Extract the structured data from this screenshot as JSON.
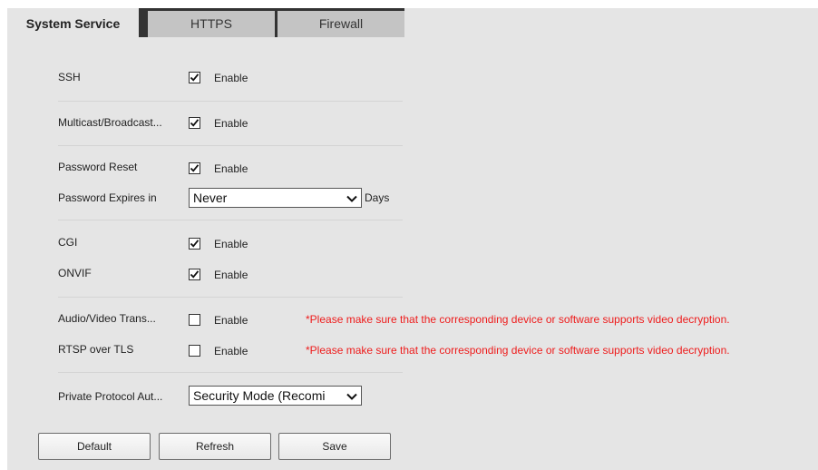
{
  "tabs": [
    {
      "label": "System Service",
      "active": true
    },
    {
      "label": "HTTPS",
      "active": false
    },
    {
      "label": "Firewall",
      "active": false
    }
  ],
  "settings": {
    "ssh": {
      "label": "SSH",
      "checked": true,
      "option": "Enable"
    },
    "multicast": {
      "label": "Multicast/Broadcast...",
      "checked": true,
      "option": "Enable"
    },
    "password_reset": {
      "label": "Password Reset",
      "checked": true,
      "option": "Enable"
    },
    "password_expires": {
      "label": "Password Expires in",
      "value": "Never",
      "unit": "Days"
    },
    "cgi": {
      "label": "CGI",
      "checked": true,
      "option": "Enable"
    },
    "onvif": {
      "label": "ONVIF",
      "checked": true,
      "option": "Enable"
    },
    "av_transmission": {
      "label": "Audio/Video Trans...",
      "checked": false,
      "option": "Enable",
      "warning": "*Please make sure that the corresponding device or software supports video decryption."
    },
    "rtsp_tls": {
      "label": "RTSP over TLS",
      "checked": false,
      "option": "Enable",
      "warning": "*Please make sure that the corresponding device or software supports video decryption."
    },
    "private_protocol": {
      "label": "Private Protocol Aut...",
      "value": "Security Mode (Recomi"
    }
  },
  "buttons": {
    "default": "Default",
    "refresh": "Refresh",
    "save": "Save"
  },
  "colors": {
    "tabbar": "#333333",
    "panel": "#e5e5e5",
    "warning": "#ee1c1c"
  }
}
